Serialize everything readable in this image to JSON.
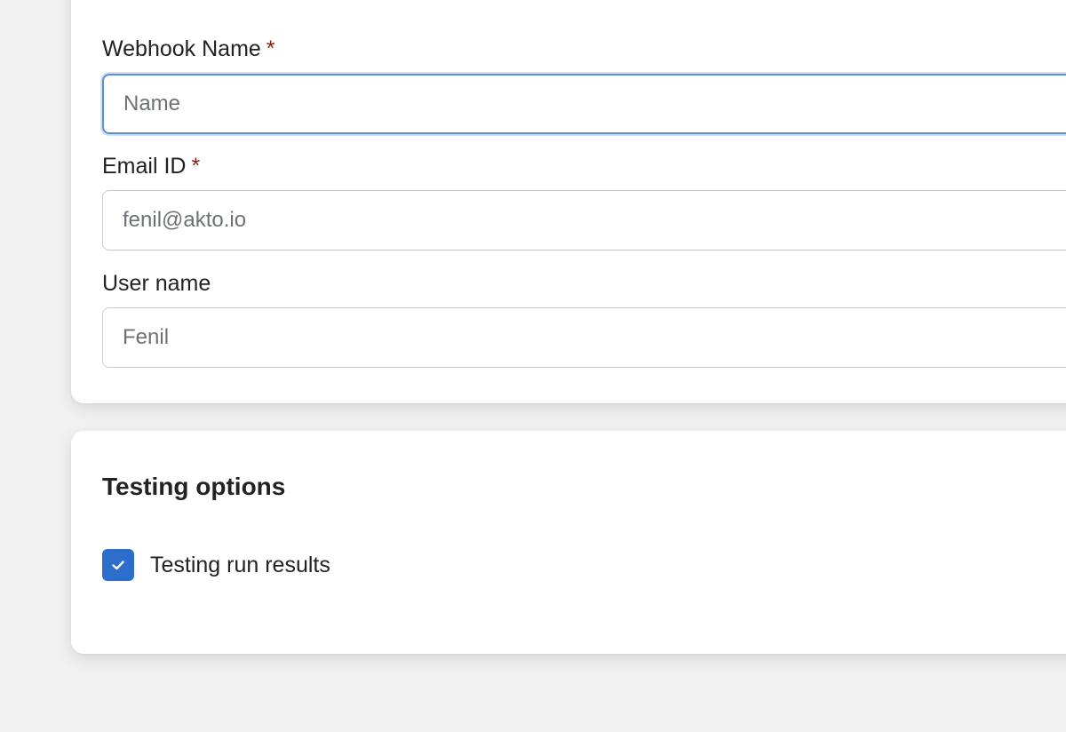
{
  "form": {
    "webhook_name": {
      "label": "Webhook Name",
      "required_mark": "*",
      "placeholder": "Name",
      "value": ""
    },
    "email": {
      "label": "Email ID",
      "required_mark": "*",
      "placeholder": "fenil@akto.io",
      "value": ""
    },
    "user_name": {
      "label": "User name",
      "placeholder": "Fenil",
      "value": ""
    }
  },
  "testing_options": {
    "title": "Testing options",
    "checkbox": {
      "label": "Testing run results",
      "checked": true
    }
  },
  "colors": {
    "accent": "#2c6ecb",
    "focus_border": "#5b8ed6",
    "required": "#8e1f0b",
    "background": "#f1f1f1"
  }
}
